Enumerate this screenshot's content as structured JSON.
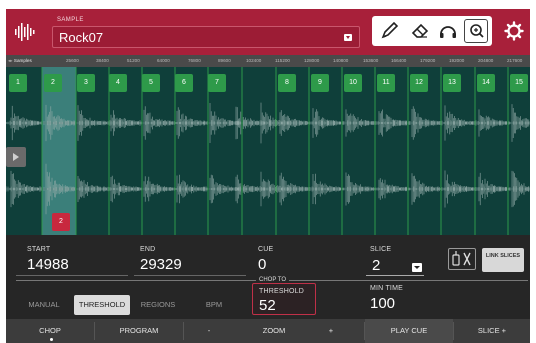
{
  "header": {
    "sample_label": "SAMPLE",
    "sample_name": "Rock07"
  },
  "icons": {
    "logo": "waveform-logo-icon",
    "pencil": "pencil-icon",
    "eraser": "eraser-icon",
    "headphones": "headphones-icon",
    "zoom": "zoom-icon",
    "gear": "gear-icon"
  },
  "ruler": {
    "label": "Samples",
    "ticks": [
      "25600",
      "38400",
      "51200",
      "64000",
      "76800",
      "89600",
      "102400",
      "115200",
      "128000",
      "140800",
      "153600",
      "166400",
      "179200",
      "192000",
      "204800",
      "217600"
    ]
  },
  "markers": [
    "1",
    "2",
    "3",
    "4",
    "5",
    "6",
    "7",
    "8",
    "9",
    "10",
    "11",
    "12",
    "13",
    "14",
    "15"
  ],
  "end_marker": "2",
  "params": {
    "start_label": "START",
    "start_value": "14988",
    "end_label": "END",
    "end_value": "29329",
    "cue_label": "CUE",
    "cue_value": "0",
    "slice_label": "SLICE",
    "slice_value": "2",
    "link_slices": "LINK SLICES",
    "chop_to": "CHOP TO",
    "modes": [
      "MANUAL",
      "THRESHOLD",
      "REGIONS",
      "BPM"
    ],
    "selected_mode": "THRESHOLD",
    "threshold_label": "THRESHOLD",
    "threshold_value": "52",
    "min_time_label": "MIN TIME",
    "min_time_value": "100"
  },
  "bottom": {
    "chop": "CHOP",
    "program": "PROGRAM",
    "zoom_minus": "-",
    "zoom": "ZOOM",
    "zoom_plus": "+",
    "play_cue": "PLAY CUE",
    "slice_plus": "SLICE +"
  },
  "colors": {
    "header": "#a8203a",
    "waveform_bg": "#0f3f3a",
    "marker_green": "#2e9a4a",
    "accent_red": "#c03048",
    "selected_region": "#3b7f7a"
  }
}
